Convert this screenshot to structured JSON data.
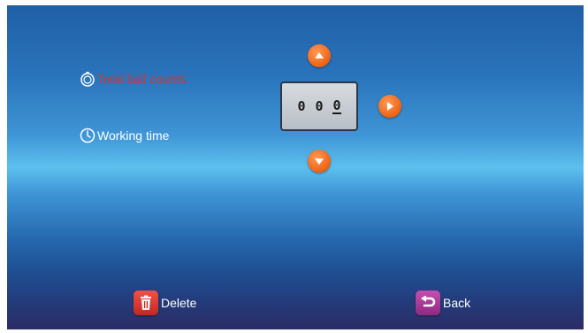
{
  "options": {
    "total_ball_counts": {
      "label": "Total ball counts",
      "icon": "stopwatch-icon",
      "color": "#d93232"
    },
    "working_time": {
      "label": "Working time",
      "icon": "clock-icon",
      "color": "#ffffff"
    }
  },
  "counter": {
    "digits": [
      "0",
      "0",
      "0"
    ],
    "active_index": 2
  },
  "controls": {
    "up": "arrow-up-icon",
    "right": "arrow-right-icon",
    "down": "arrow-down-icon",
    "accent": "#f06a1c"
  },
  "actions": {
    "delete": {
      "label": "Delete",
      "icon": "trash-icon",
      "color": "#d8332b"
    },
    "back": {
      "label": "Back",
      "icon": "back-arrow-icon",
      "color": "#a83a98"
    }
  }
}
